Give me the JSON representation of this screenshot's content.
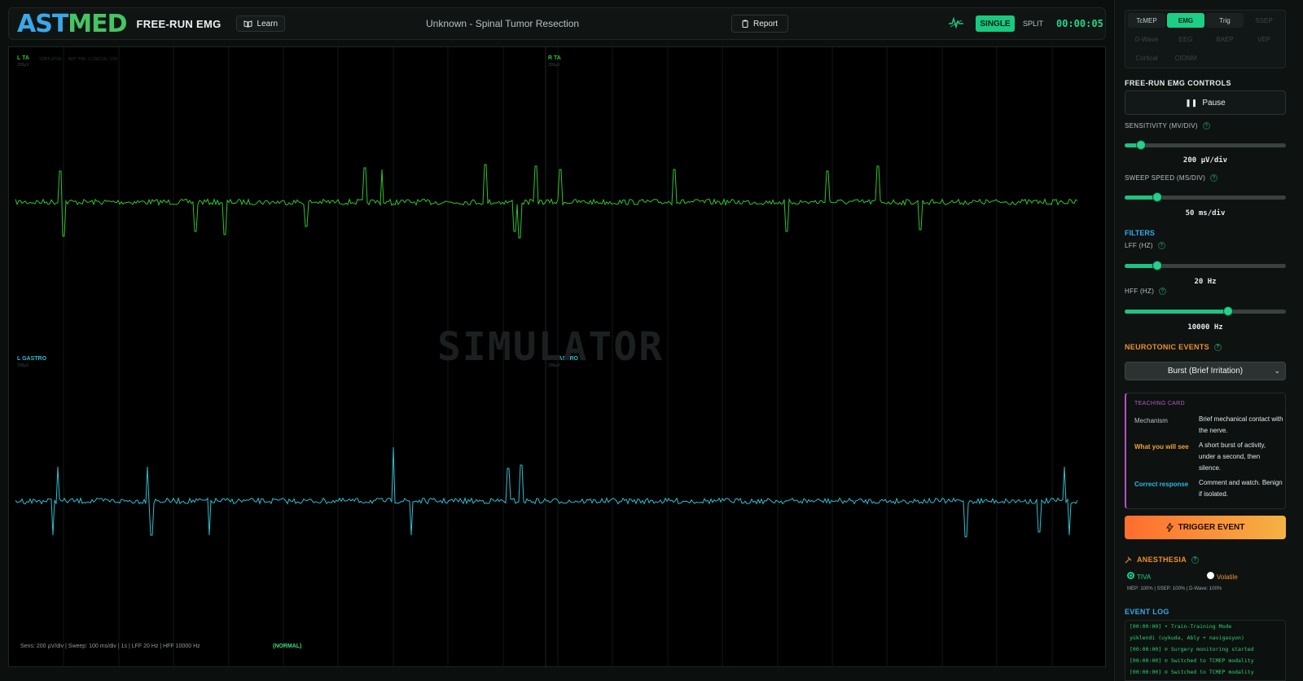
{
  "header": {
    "logo_part1": "AST",
    "logo_part2": "MED",
    "app_title": "FREE-RUN EMG",
    "learn_label": "Learn",
    "case_title": "Unknown - Spinal Tumor Resection",
    "report_label": "Report",
    "single_label": "SINGLE",
    "split_label": "SPLIT",
    "timer": "00:00:05",
    "accent": "#19c97f"
  },
  "scope": {
    "channels": [
      {
        "label": "L TA",
        "sens": "200µV",
        "color": "#2ec42e"
      },
      {
        "label": "R TA",
        "sens": "200µV",
        "color": "#2ec42e"
      },
      {
        "label": "L GASTRO",
        "sens": "200µV",
        "color": "#2bbfcf"
      },
      {
        "label": "R GASTRO",
        "sens": "200µV",
        "color": "#2bbfcf"
      }
    ],
    "sim_note": "SIMULATOR - NOT FOR CLINICAL USE",
    "watermark": "SIMULATOR",
    "status_line": "Sens: 200 µV/div | Sweep: 100 ms/div | 1s | LFF 20 Hz | HFF 10000 Hz",
    "status_tag": "(NORMAL)"
  },
  "sidebar": {
    "modalities": [
      "TcMEP",
      "EMG",
      "Trig",
      "SSEP",
      "D-Wave",
      "EEG",
      "BAEP",
      "VEP",
      "Cortical",
      "CIONM"
    ],
    "active_modality": "EMG",
    "controls_title": "FREE-RUN EMG CONTROLS",
    "pause_label": "Pause",
    "sensitivity_label": "SENSITIVITY (MV/DIV)",
    "sensitivity_value": "200 µV/div",
    "sensitivity_level": 0.1,
    "sweep_label": "SWEEP SPEED (MS/DIV)",
    "sweep_value": "50 ms/div",
    "sweep_level": 0.2,
    "filters_title": "FILTERS",
    "lff_label": "LFF (HZ)",
    "lff_value": "20 Hz",
    "lff_level": 0.2,
    "hff_label": "HFF (HZ)",
    "hff_value": "10000 Hz",
    "hff_level": 0.64,
    "neuro_title": "NEUROTONIC EVENTS",
    "neuro_selected": "Burst (Brief Irritation)",
    "teaching": {
      "title": "TEACHING CARD",
      "mechanism_key": "Mechanism",
      "mechanism_val": "Brief mechanical contact with the nerve.",
      "see_key": "What you will see",
      "see_val": "A short burst of activity, under a second, then silence.",
      "response_key": "Correct response",
      "response_val": "Comment and watch. Benign if isolated."
    },
    "trigger_label": "TRIGGER EVENT",
    "anesthesia_title": "ANESTHESIA",
    "tiva_label": "TIVA",
    "volatile_label": "Volatile",
    "anesthesia_note": "MEP: 100% | SSEP: 100% | D-Wave: 100%",
    "log_title": "EVENT LOG",
    "log": [
      "[00:00:00] • Train-Training Mode",
      "yüklendi (uykuda, Ably + navigasyon)",
      "[00:00:00] ⊙ Surgery monitoring started",
      "[00:00:00] ⊙ Switched to TCMEP modality",
      "[00:00:00] ⊙ Switched to TCMEP modality"
    ]
  }
}
